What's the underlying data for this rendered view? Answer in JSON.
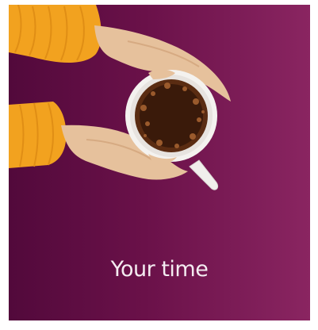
{
  "card": {
    "caption": "Your time"
  },
  "colors": {
    "background_start": "#52093b",
    "background_end": "#8a2561",
    "sleeve": "#f5a623",
    "skin": "#e9c8a6",
    "cup": "#f4f1ee",
    "coffee": "#3b1d0c"
  },
  "icons": {
    "illustration": "hands-holding-coffee-cup-icon"
  }
}
